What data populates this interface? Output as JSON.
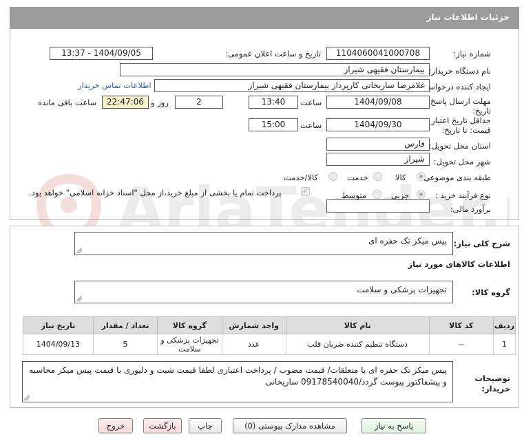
{
  "header": {
    "title": "جزئیات اطلاعات نیاز"
  },
  "form": {
    "need_number_label": "شماره نیاز:",
    "need_number": "1104060041000708",
    "announce_label": "تاریخ و ساعت اعلان عمومی:",
    "announce_value": "1404/09/05 - 13:37",
    "buyer_org_label": "نام دستگاه خریدار:",
    "buyer_org": "بیمارستان فقیهی شیراز",
    "creator_label": "ایجاد کننده درخواست:",
    "creator": "غلامرضا ساریخانی کارپرداز بیمارستان فقیهی شیراز",
    "contact_link": "اطلاعات تماس خریدار",
    "deadline_label_1": "مهلت ارسال پاسخ: تا",
    "deadline_label_2": "تاریخ:",
    "deadline_date": "1404/09/08",
    "time_label": "ساعت",
    "deadline_time": "13:40",
    "days_value": "2",
    "days_label": "روز و",
    "remaining_time": "22:47:06",
    "remaining_label": "ساعت باقی مانده",
    "validity_label_1": "حداقل تاریخ اعتبار",
    "validity_label_2": "قیمت: تا تاریخ:",
    "validity_date": "1404/09/30",
    "validity_time_label": "ساعت",
    "validity_time": "15:00",
    "province_label": "استان محل تحویل:",
    "province": "فارس",
    "city_label": "شهر محل تحویل:",
    "city": "شیراز",
    "category_label": "طبقه بندی موضوعی:",
    "category_options": [
      "کالا",
      "خدمت",
      "کالا/خدمت"
    ],
    "process_label": "نوع فرآیند خرید :",
    "process_options": [
      "جزیی",
      "متوسط"
    ],
    "payment_note": "پرداخت تمام یا بخشی از مبلغ خرید،از محل \"اسناد خزانه اسلامی\" خواهد بود.",
    "estimate_label": "برآورد مالی:",
    "estimate_value": ""
  },
  "details": {
    "summary_label": "شرح کلی نیاز:",
    "summary": "پیس میکز تک حفره ای",
    "goods_info_title": "اطلاعات کالاهای مورد نیاز",
    "goods_group_label": "گروه کالا:",
    "goods_group": "تجهیزات پزشکی و سلامت",
    "table": {
      "headers": [
        "ردیف",
        "کد کالا",
        "نام کالا",
        "واحد شمارش",
        "گروه کالا",
        "تعداد / مقدار",
        "تاریخ نیاز"
      ],
      "rows": [
        [
          "1",
          "--",
          "دستگاه تنظیم کننده ضربان قلب",
          "عدد",
          "تجهیزات پزشکی و سلامت",
          "5",
          "1404/09/13"
        ]
      ]
    },
    "buyer_notes_label_1": "توضیحات",
    "buyer_notes_label_2": "خریدار:",
    "buyer_notes": "پیس میکز تک حفره ای با متعلقات/ قیمت مصوب / پرداخت اعتباری لطفا قیمت شیت و دلیوری با قیمت پیس میکر محاسبه و پیشفاکتور پیوست گردد/09178540040 ساریخانی"
  },
  "buttons": {
    "reply": "پاسخ به نیاز",
    "attachments": "مشاهده مدارک پیوستی (0)",
    "print": "چاپ",
    "back": "بازگشت",
    "exit": "خروج"
  },
  "colors": {
    "header_bg": "#9b9b9b",
    "link": "#2a62b8",
    "remaining_bg": "#f5f1c9"
  }
}
